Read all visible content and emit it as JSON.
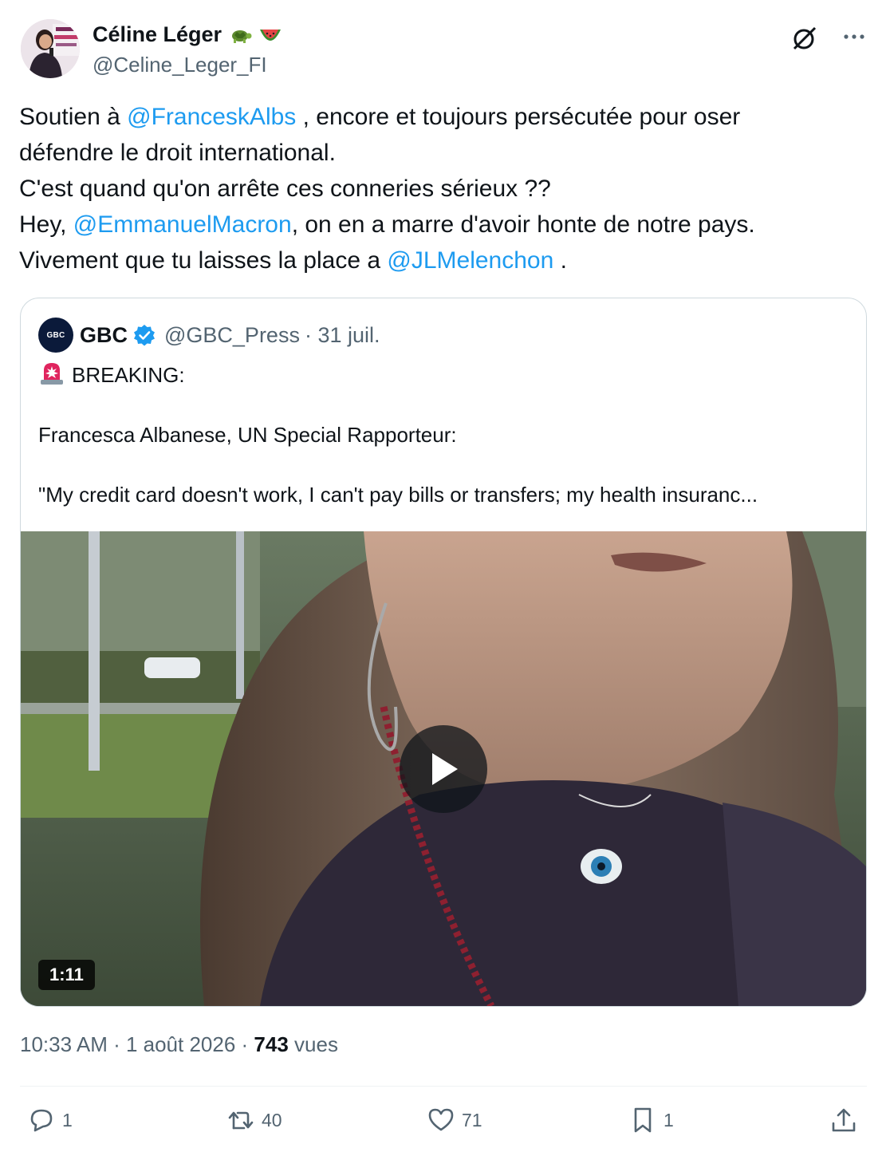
{
  "author": {
    "display_name": "Céline Léger",
    "handle": "@Celine_Leger_FI",
    "badges": [
      "turtle-emoji",
      "watermelon-emoji"
    ]
  },
  "tweet": {
    "text_lines": [
      [
        "Soutien à ",
        "@FranceskAlbs",
        " , encore et toujours persécutée pour oser"
      ],
      [
        "défendre le droit international."
      ],
      [
        "C'est quand qu'on arrête ces conneries sérieux ??"
      ],
      [
        "Hey, ",
        "@EmmanuelMacron",
        ", on en a marre d'avoir honte de notre pays."
      ],
      [
        "Vivement que tu laisses la place a ",
        "@JLMelenchon",
        " ."
      ]
    ]
  },
  "quote": {
    "avatar_text": "GBC",
    "name": "GBC",
    "handle": "@GBC_Press",
    "date": "· 31 juil.",
    "breaking": "BREAKING:",
    "line2": "Francesca Albanese, UN Special Rapporteur:",
    "line3": "\"My credit card doesn't work, I can't pay bills or transfers; my health insuranc...",
    "video_duration": "1:11"
  },
  "meta": {
    "time": "10:33 AM · 1 août 2026 · ",
    "views_count": "743",
    "views_label": " vues"
  },
  "actions": {
    "replies": "1",
    "reposts": "40",
    "likes": "71",
    "bookmarks": "1"
  },
  "colors": {
    "link": "#1d9bf0",
    "secondary_text": "#536471",
    "verified": "#1d9bf0",
    "border": "#cfd9de"
  }
}
